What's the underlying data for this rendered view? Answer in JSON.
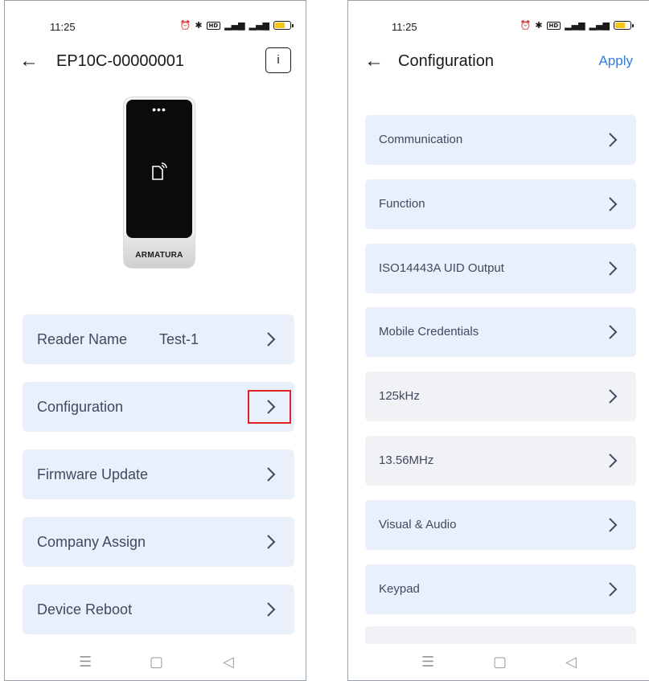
{
  "left_screen": {
    "status": {
      "time": "11:25"
    },
    "header": {
      "title": "EP10C-00000001",
      "info_label": "i"
    },
    "device": {
      "brand": "ARMATURA",
      "dots": "•••"
    },
    "menu": [
      {
        "label": "Reader Name",
        "value": "Test-1"
      },
      {
        "label": "Configuration",
        "value": ""
      },
      {
        "label": "Firmware Update",
        "value": ""
      },
      {
        "label": "Company Assign",
        "value": ""
      },
      {
        "label": "Device Reboot",
        "value": ""
      }
    ]
  },
  "right_screen": {
    "status": {
      "time": "11:25"
    },
    "header": {
      "title": "Configuration",
      "apply_label": "Apply"
    },
    "menu": [
      {
        "label": "Communication"
      },
      {
        "label": "Function"
      },
      {
        "label": "ISO14443A UID Output"
      },
      {
        "label": "Mobile Credentials"
      },
      {
        "label": "125kHz"
      },
      {
        "label": "13.56MHz"
      },
      {
        "label": "Visual & Audio"
      },
      {
        "label": "Keypad"
      }
    ]
  },
  "colors": {
    "accent": "#2e7de0",
    "row_blue": "#e9f0fb",
    "row_grey": "#f0f2f5",
    "highlight": "#e02424",
    "battery": "#f5c518"
  },
  "icons": {
    "back": "arrow-left-icon",
    "chevron": "chevron-right-icon",
    "nfc": "nfc-card-icon",
    "nav_menu": "menu-lines-icon",
    "nav_home": "square-home-icon",
    "nav_back": "triangle-back-icon"
  }
}
